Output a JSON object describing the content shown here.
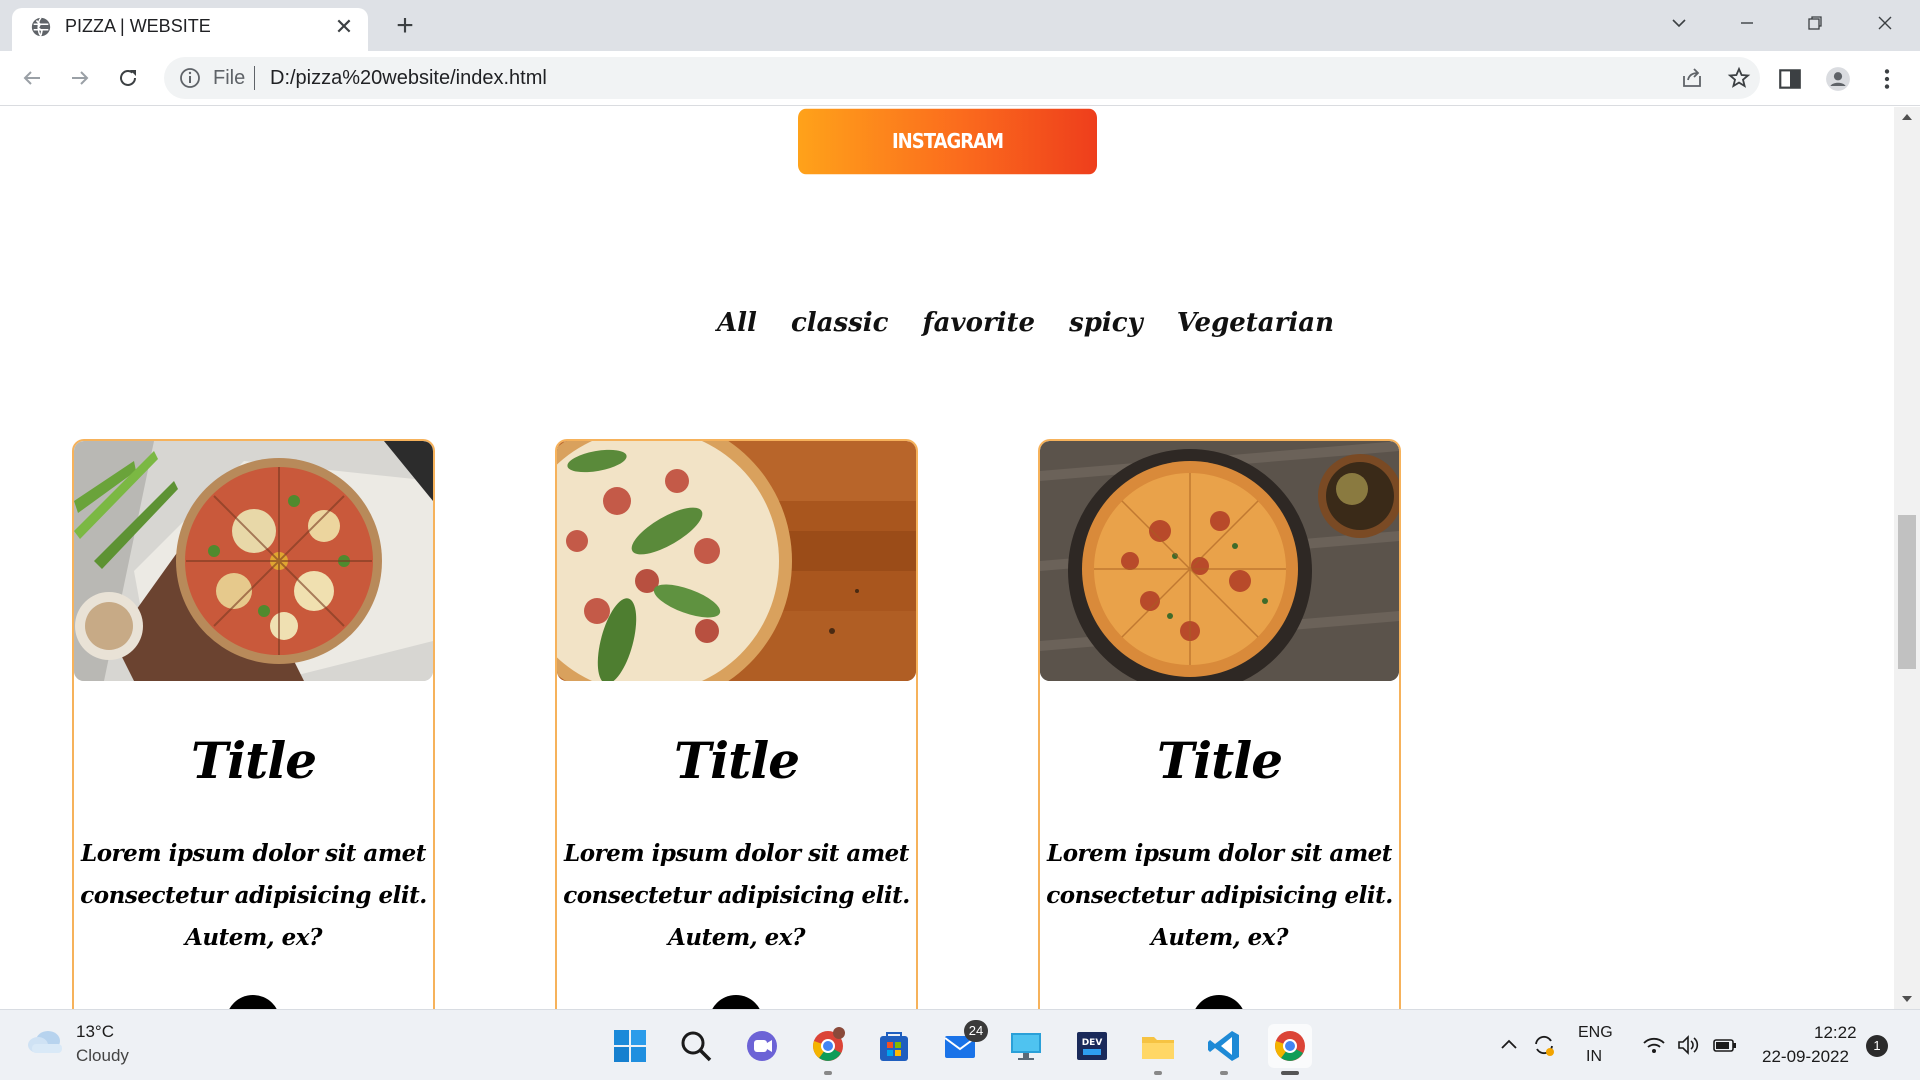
{
  "browser": {
    "tab_title": "PIZZA | WEBSITE",
    "tab_close": "✕",
    "new_tab": "+",
    "address_scheme": "File",
    "address_url": "D:/pizza%20website/index.html"
  },
  "page": {
    "instagram_button": "INSTAGRAM",
    "filters": [
      "All",
      "classic",
      "favorite",
      "spicy",
      "Vegetarian"
    ],
    "cards": [
      {
        "title": "Title",
        "description": "Lorem ipsum dolor sit amet consectetur adipisicing elit. Autem, ex?"
      },
      {
        "title": "Title",
        "description": "Lorem ipsum dolor sit amet consectetur adipisicing elit. Autem, ex?"
      },
      {
        "title": "Title",
        "description": "Lorem ipsum dolor sit amet consectetur adipisicing elit. Autem, ex?"
      }
    ],
    "accent_border": "#f6b25b",
    "button_gradient": [
      "#ffa21a",
      "#ee3e1c"
    ]
  },
  "taskbar": {
    "weather_temp": "13°C",
    "weather_condition": "Cloudy",
    "mail_badge": "24",
    "lang_top": "ENG",
    "lang_bottom": "IN",
    "time": "12:22",
    "date": "22-09-2022",
    "notification_count": "1",
    "apps": [
      "start-icon",
      "search-icon",
      "teams-chat-icon",
      "chrome-profile-icon",
      "microsoft-store-icon",
      "mail-icon",
      "remote-desktop-icon",
      "dev-home-icon",
      "file-explorer-icon",
      "vscode-icon",
      "chrome-icon"
    ]
  }
}
